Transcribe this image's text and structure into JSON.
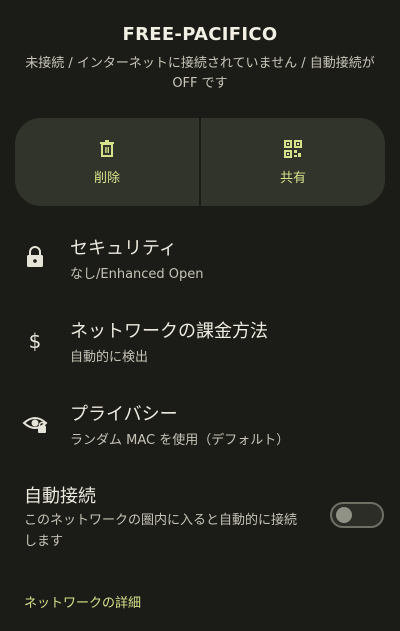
{
  "header": {
    "title": "FREE-PACIFICO",
    "subtitle": "未接続 / インターネットに接続されていません / 自動接続が OFF です"
  },
  "actions": {
    "delete_label": "削除",
    "share_label": "共有"
  },
  "rows": [
    {
      "title": "セキュリティ",
      "subtitle": "なし/Enhanced Open",
      "icon": "lock-icon"
    },
    {
      "title": "ネットワークの課金方法",
      "subtitle": "自動的に検出",
      "icon": "dollar-icon"
    },
    {
      "title": "プライバシー",
      "subtitle": "ランダム MAC を使用（デフォルト）",
      "icon": "eye-lock-icon"
    }
  ],
  "auto_connect": {
    "title": "自動接続",
    "subtitle": "このネットワークの圏内に入ると自動的に接続します",
    "enabled": false
  },
  "details_link": "ネットワークの詳細",
  "colors": {
    "background": "#1b1b17",
    "accent": "#d7e08a",
    "card": "#31342a"
  }
}
